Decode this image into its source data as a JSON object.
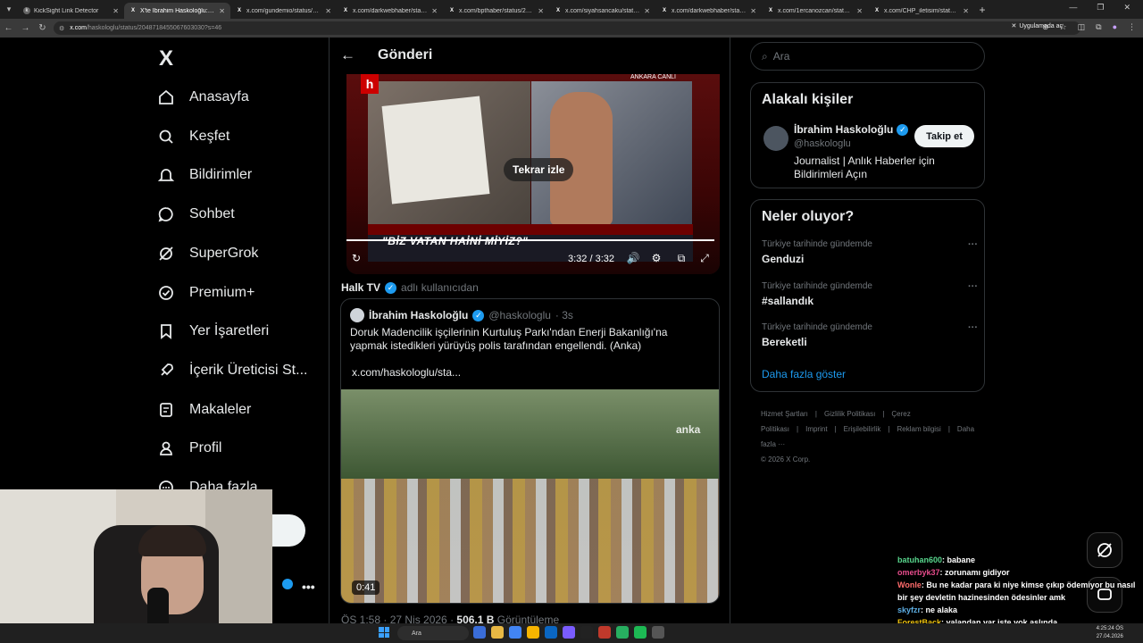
{
  "browser": {
    "tabs": [
      {
        "label": "KickSight Link Detector",
        "fav": "k",
        "active": false
      },
      {
        "label": "X'te İbrahim Haskoloğlu: \"Açık",
        "fav": "X",
        "active": true
      },
      {
        "label": "x.com/gundemio/status/20487",
        "fav": "X",
        "active": false
      },
      {
        "label": "x.com/darkwebhaber/status/2",
        "fav": "X",
        "active": false
      },
      {
        "label": "x.com/bpthaber/status/20487",
        "fav": "X",
        "active": false
      },
      {
        "label": "x.com/siyahsancaku/status/204",
        "fav": "X",
        "active": false
      },
      {
        "label": "x.com/darkwebhaber/status/2",
        "fav": "X",
        "active": false
      },
      {
        "label": "x.com/1ercanozcan/status/204",
        "fav": "X",
        "active": false
      },
      {
        "label": "x.com/CHP_iletisim/status/204",
        "fav": "X",
        "active": false
      }
    ],
    "url_host": "x.com",
    "url_path": "/haskologlu/status/2048718455067603030?s=46",
    "app_pill": "Uygulamada aç"
  },
  "nav": {
    "logo": "X",
    "items": [
      {
        "label": "Anasayfa",
        "icon": "home-icon"
      },
      {
        "label": "Keşfet",
        "icon": "search-icon"
      },
      {
        "label": "Bildirimler",
        "icon": "bell-icon"
      },
      {
        "label": "Sohbet",
        "icon": "chat-icon"
      },
      {
        "label": "SuperGrok",
        "icon": "grok-icon"
      },
      {
        "label": "Premium+",
        "icon": "premium-icon"
      },
      {
        "label": "Yer İşaretleri",
        "icon": "bookmark-icon"
      },
      {
        "label": "İçerik Üreticisi St...",
        "icon": "rocket-icon"
      },
      {
        "label": "Makaleler",
        "icon": "article-icon"
      },
      {
        "label": "Profil",
        "icon": "person-icon"
      },
      {
        "label": "Daha fazla",
        "icon": "more-icon"
      }
    ],
    "more_dots": "•••"
  },
  "post": {
    "header_title": "Gönderi",
    "video1": {
      "replay_label": "Tekrar izle",
      "time": "3:32 / 3:32",
      "headline": "\"BİZ VATAN HAİNİ MİYİZ?\"",
      "ankara": "ANKARA  CANLI",
      "progress_percent": 100
    },
    "quoted_by_name": "Halk TV",
    "quoted_by_suffix": "adlı kullanıcıdan",
    "quote": {
      "author": "İbrahim Haskoloğlu",
      "handle": "@haskologlu",
      "age": "· 3s",
      "text": "Doruk Madencilik işçilerinin Kurtuluş Parkı'ndan Enerji Bakanlığı'na yapmak istedikleri yürüyüş polis tarafından engellendi. (Anka)",
      "link": "x.com/haskologlu/sta...",
      "video_time": "0:41",
      "video_watermark": "anka"
    },
    "meta_time": "ÖS 1:58 · 27 Nis 2026 · ",
    "meta_views": "506,1 B",
    "meta_views_label": " Görüntüleme"
  },
  "right": {
    "search_placeholder": "Ara",
    "related_title": "Alakalı kişiler",
    "person_name": "İbrahim Haskoloğlu",
    "person_handle": "@haskologlu",
    "follow_label": "Takip et",
    "person_bio": "Journalist | Anlık Haberler için Bildirimleri Açın",
    "trends_title": "Neler oluyor?",
    "trends": [
      {
        "context": "Türkiye tarihinde gündemde",
        "name": "Genduzi"
      },
      {
        "context": "Türkiye tarihinde gündemde",
        "name": "#sallandık"
      },
      {
        "context": "Türkiye tarihinde gündemde",
        "name": "Bereketli"
      }
    ],
    "show_more": "Daha fazla göster",
    "footer": [
      "Hizmet Şartları",
      "|",
      "Gizlilik Politikası",
      "|",
      "Çerez Politikası",
      "|",
      "Imprint",
      "|",
      "Erişilebilirlik",
      "|",
      "Reklam bilgisi",
      "|",
      "Daha fazla ···",
      "© 2026 X Corp."
    ]
  },
  "chat": [
    {
      "user": "batuhan600",
      "color": "#58d68d",
      "msg": ": babane"
    },
    {
      "user": "omerbyk37",
      "color": "#e74c8c",
      "msg": ": zorunamı gidiyor"
    },
    {
      "user": "Wonle",
      "color": "#ff6b6b",
      "msg": ": Bu ne kadar para ki niye kimse çıkıp ödemiyor bu nasıl bir şey devletin hazinesinden ödesinler amk"
    },
    {
      "user": "skyfzr",
      "color": "#5dade2",
      "msg": ": ne alaka"
    },
    {
      "user": "ForestBack",
      "color": "#f1c40f",
      "msg": ": yalandan var işte yok aslında"
    }
  ],
  "taskbar": {
    "search": "Ara",
    "time": "4:25:24 ÖS",
    "date": "27.04.2026"
  }
}
